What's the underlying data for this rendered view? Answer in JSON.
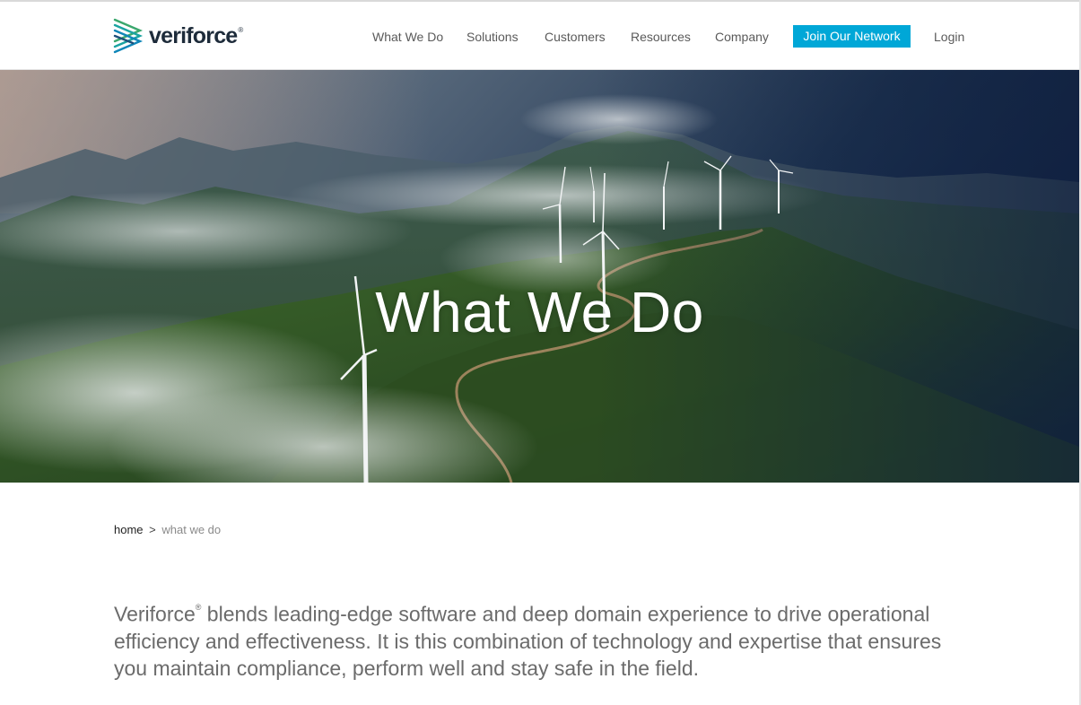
{
  "brand": {
    "name": "veriforce",
    "registered_mark": "®",
    "colors": {
      "teal": "#00a7d7",
      "navy": "#1d2b3a",
      "green": "#3aa76d"
    }
  },
  "nav": {
    "items": [
      {
        "label": "What We Do"
      },
      {
        "label": "Solutions"
      },
      {
        "label": "Customers"
      },
      {
        "label": "Resources"
      },
      {
        "label": "Company"
      }
    ],
    "cta_label": "Join Our Network",
    "login_label": "Login"
  },
  "hero": {
    "title": "What We Do",
    "image_alt": "wind-turbines-on-misty-mountains"
  },
  "breadcrumb": {
    "home": "home",
    "separator": ">",
    "current": "what we do"
  },
  "intro": {
    "brand": "Veriforce",
    "mark": "®",
    "text": " blends leading-edge software and deep domain experience to drive operational efficiency and effectiveness. It is this combination of technology and expertise that ensures you maintain compliance, perform well and stay safe in the field."
  }
}
